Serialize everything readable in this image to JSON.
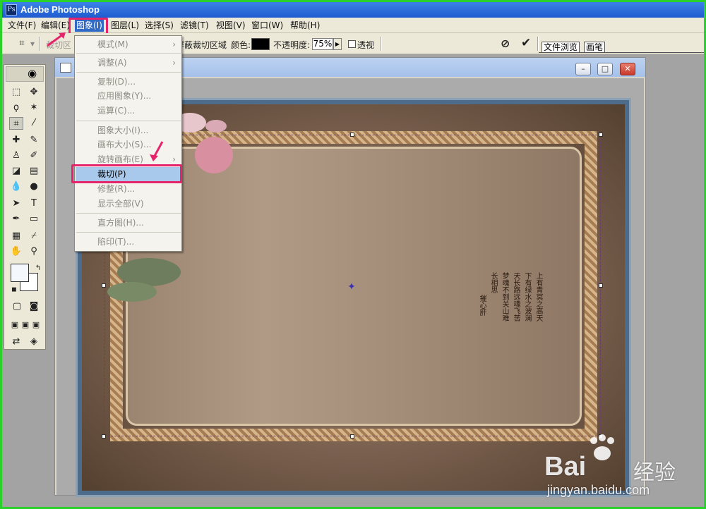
{
  "app": {
    "title": "Adobe Photoshop",
    "icon": "photoshop-icon"
  },
  "menubar": {
    "items": [
      "文件(F)",
      "编辑(E)",
      "图象(I)",
      "图层(L)",
      "选择(S)",
      "滤镜(T)",
      "视图(V)",
      "窗口(W)",
      "帮助(H)"
    ],
    "active": "图象(I)"
  },
  "options": {
    "crop_area_label": "裁切区",
    "shield_label": "屏蔽裁切区域",
    "color_label": "颜色:",
    "color_value": "#000000",
    "opacity_label": "不透明度:",
    "opacity_value": "75%",
    "perspective_label": "透视",
    "palette_tabs": [
      "文件浏览",
      "画笔"
    ]
  },
  "image_menu": {
    "items": [
      {
        "label": "模式(M)",
        "submenu": true
      },
      {
        "label": "调整(A)",
        "submenu": true
      },
      {
        "label": "复制(D)...",
        "submenu": false
      },
      {
        "label": "应用图象(Y)...",
        "submenu": false
      },
      {
        "label": "运算(C)...",
        "submenu": false
      },
      {
        "label": "图象大小(I)...",
        "submenu": false
      },
      {
        "label": "画布大小(S)...",
        "submenu": false
      },
      {
        "label": "旋转画布(E)",
        "submenu": true
      },
      {
        "label": "裁切(P)",
        "submenu": false,
        "highlighted": true
      },
      {
        "label": "修整(R)...",
        "submenu": false
      },
      {
        "label": "显示全部(V)",
        "submenu": false
      },
      {
        "label": "直方图(H)...",
        "submenu": false
      },
      {
        "label": "陷印(T)...",
        "submenu": false
      }
    ]
  },
  "image_poem": {
    "lines": [
      "上有青冥之高天",
      "下有绿水之波澜",
      "天长路远魂飞苦",
      "梦魂不到关山难",
      "长相思",
      "摧心肝"
    ]
  },
  "colors": {
    "highlight_box": "#e6246b",
    "menu_highlight": "#a8c8ec",
    "border_green": "#2bd12b"
  },
  "watermark": {
    "brand": "Bai",
    "brand_suffix": "经验",
    "url": "jingyan.baidu.com"
  }
}
